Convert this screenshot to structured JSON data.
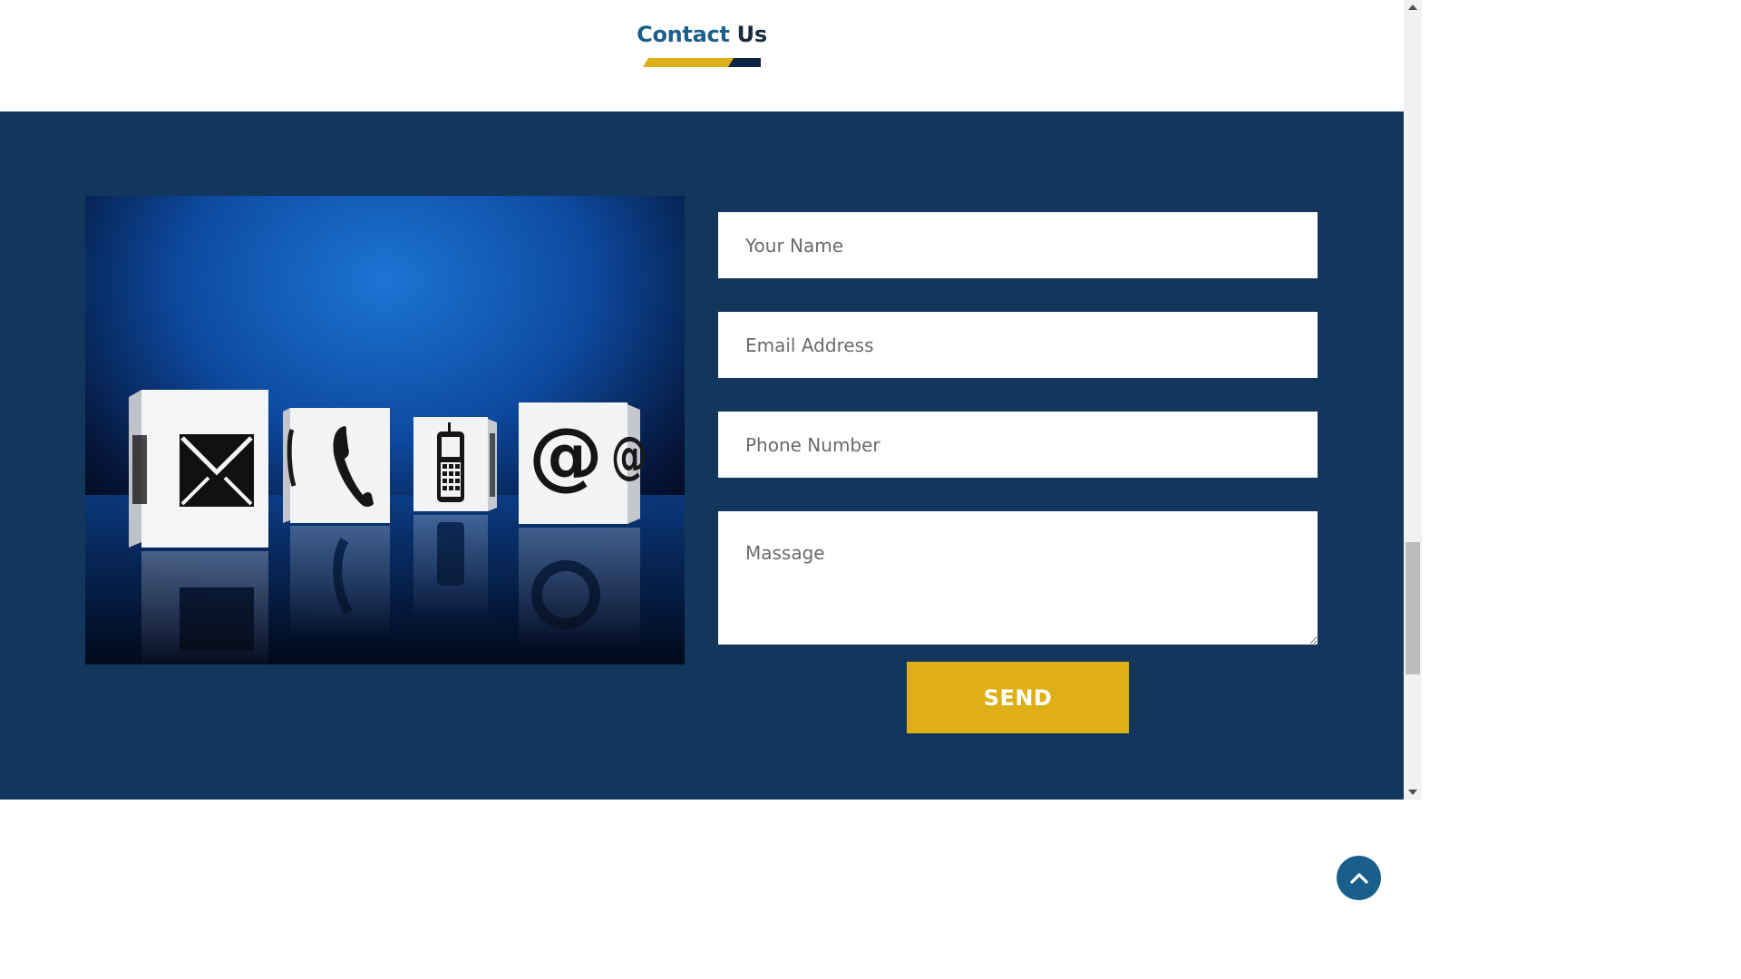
{
  "heading": {
    "title_part1": "Contact",
    "title_part2": " Us"
  },
  "contact_image": {
    "icons": [
      "envelope-icon",
      "phone-handset-icon",
      "mobile-phone-icon",
      "at-sign-icon"
    ],
    "at_glyph": "@"
  },
  "form": {
    "name_placeholder": "Your Name",
    "email_placeholder": "Email Address",
    "phone_placeholder": "Phone Number",
    "message_placeholder": "Massage",
    "send_label": "SEND"
  },
  "colors": {
    "band_background": "#13375c",
    "accent_yellow": "#deaf16",
    "title_blue": "#1b5f8a",
    "title_dark": "#17293f",
    "back_to_top": "#1a5e8c"
  },
  "icons": {
    "back_to_top": "chevron-up-icon"
  }
}
